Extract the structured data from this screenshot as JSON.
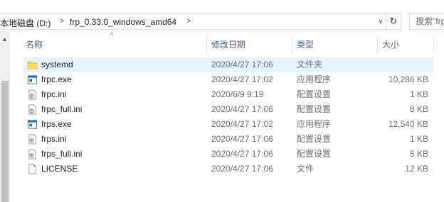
{
  "address": {
    "crumbs": [
      "本地磁盘 (D:)",
      "frp_0.33.0_windows_amd64"
    ],
    "separator": ">",
    "dropdown_glyph": "∨",
    "refresh_glyph": "↻",
    "search_placeholder": "搜索\"frp"
  },
  "columns": {
    "name": "名称",
    "date": "修改日期",
    "type": "类型",
    "size": "大小",
    "sort_glyph": "^"
  },
  "rows": [
    {
      "name": "systemd",
      "date": "2020/4/27 17:06",
      "type": "文件夹",
      "size": "",
      "icon": "folder-icon",
      "selected": true
    },
    {
      "name": "frpc.exe",
      "date": "2020/4/27 17:02",
      "type": "应用程序",
      "size": "10,286 KB",
      "icon": "exe-icon",
      "selected": false
    },
    {
      "name": "frpc.ini",
      "date": "2020/6/9 9:19",
      "type": "配置设置",
      "size": "1 KB",
      "icon": "ini-icon",
      "selected": false
    },
    {
      "name": "frpc_full.ini",
      "date": "2020/4/27 17:06",
      "type": "配置设置",
      "size": "8 KB",
      "icon": "ini-icon",
      "selected": false
    },
    {
      "name": "frps.exe",
      "date": "2020/4/27 17:02",
      "type": "应用程序",
      "size": "12,540 KB",
      "icon": "exe-icon",
      "selected": false
    },
    {
      "name": "frps.ini",
      "date": "2020/4/27 17:06",
      "type": "配置设置",
      "size": "1 KB",
      "icon": "ini-icon",
      "selected": false
    },
    {
      "name": "frps_full.ini",
      "date": "2020/4/27 17:06",
      "type": "配置设置",
      "size": "5 KB",
      "icon": "ini-icon",
      "selected": false
    },
    {
      "name": "LICENSE",
      "date": "2020/4/27 17:06",
      "type": "文件",
      "size": "12 KB",
      "icon": "file-icon",
      "selected": false
    }
  ],
  "colors": {
    "selection": "#e5f3ff",
    "header_text": "#4c607a",
    "folder": "#f5c342",
    "exe_blue": "#2b6cc4"
  }
}
